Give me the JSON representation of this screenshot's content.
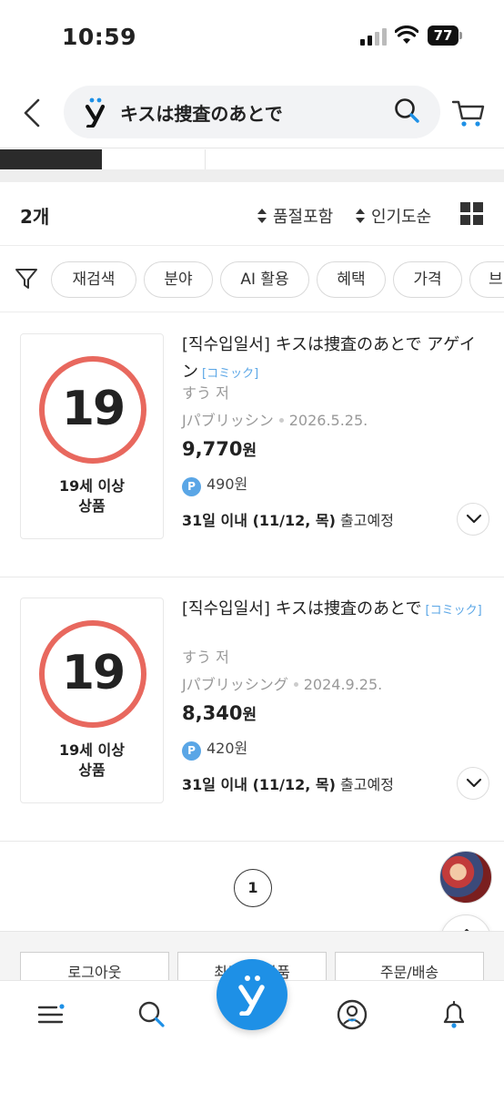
{
  "status_bar": {
    "time": "10:59",
    "battery": "77"
  },
  "search": {
    "query": "キスは捜査のあとで"
  },
  "results": {
    "count": "2개",
    "sort_options": [
      "품절포함",
      "인기도순"
    ]
  },
  "filters": [
    "재검색",
    "분야",
    "AI 활용",
    "혜택",
    "가격",
    "브"
  ],
  "products": [
    {
      "age_badge": "19",
      "age_label_1": "19세 이상",
      "age_label_2": "상품",
      "title": "[직수입일서] キスは捜査のあとで アゲイン",
      "category_tag": "[コミック]",
      "author": "すう 저",
      "publisher": "Jパブリッシン",
      "date": "2026.5.25.",
      "price_number": "9,770",
      "price_unit": "원",
      "points": "490원",
      "shipping_bold": "31일 이내 (11/12, 목)",
      "shipping_text": "출고예정"
    },
    {
      "age_badge": "19",
      "age_label_1": "19세 이상",
      "age_label_2": "상품",
      "title": "[직수입일서] キスは捜査のあとで",
      "category_tag": "[コミック]",
      "author": "すう 저",
      "publisher": "Jパブリッシング",
      "date": "2024.9.25.",
      "price_number": "8,340",
      "price_unit": "원",
      "points": "420원",
      "shipping_bold": "31일 이내 (11/12, 목)",
      "shipping_text": "출고예정"
    }
  ],
  "pagination": {
    "current": "1"
  },
  "points_badge": "P",
  "footer_buttons": [
    "로그아웃",
    "최근 본 상품",
    "주문/배송"
  ],
  "colors": {
    "accent": "#1e90e6",
    "age_ring": "#e8685e",
    "tag": "#5aa6e6"
  },
  "icons": [
    "back-arrow-icon",
    "yes24-logo-icon",
    "search-icon",
    "cart-icon",
    "sort-arrows-icon",
    "grid-view-icon",
    "filter-funnel-icon",
    "chevron-down-icon",
    "arrow-up-icon",
    "menu-icon",
    "home-logo-icon",
    "my-page-icon",
    "notification-bell-icon"
  ]
}
